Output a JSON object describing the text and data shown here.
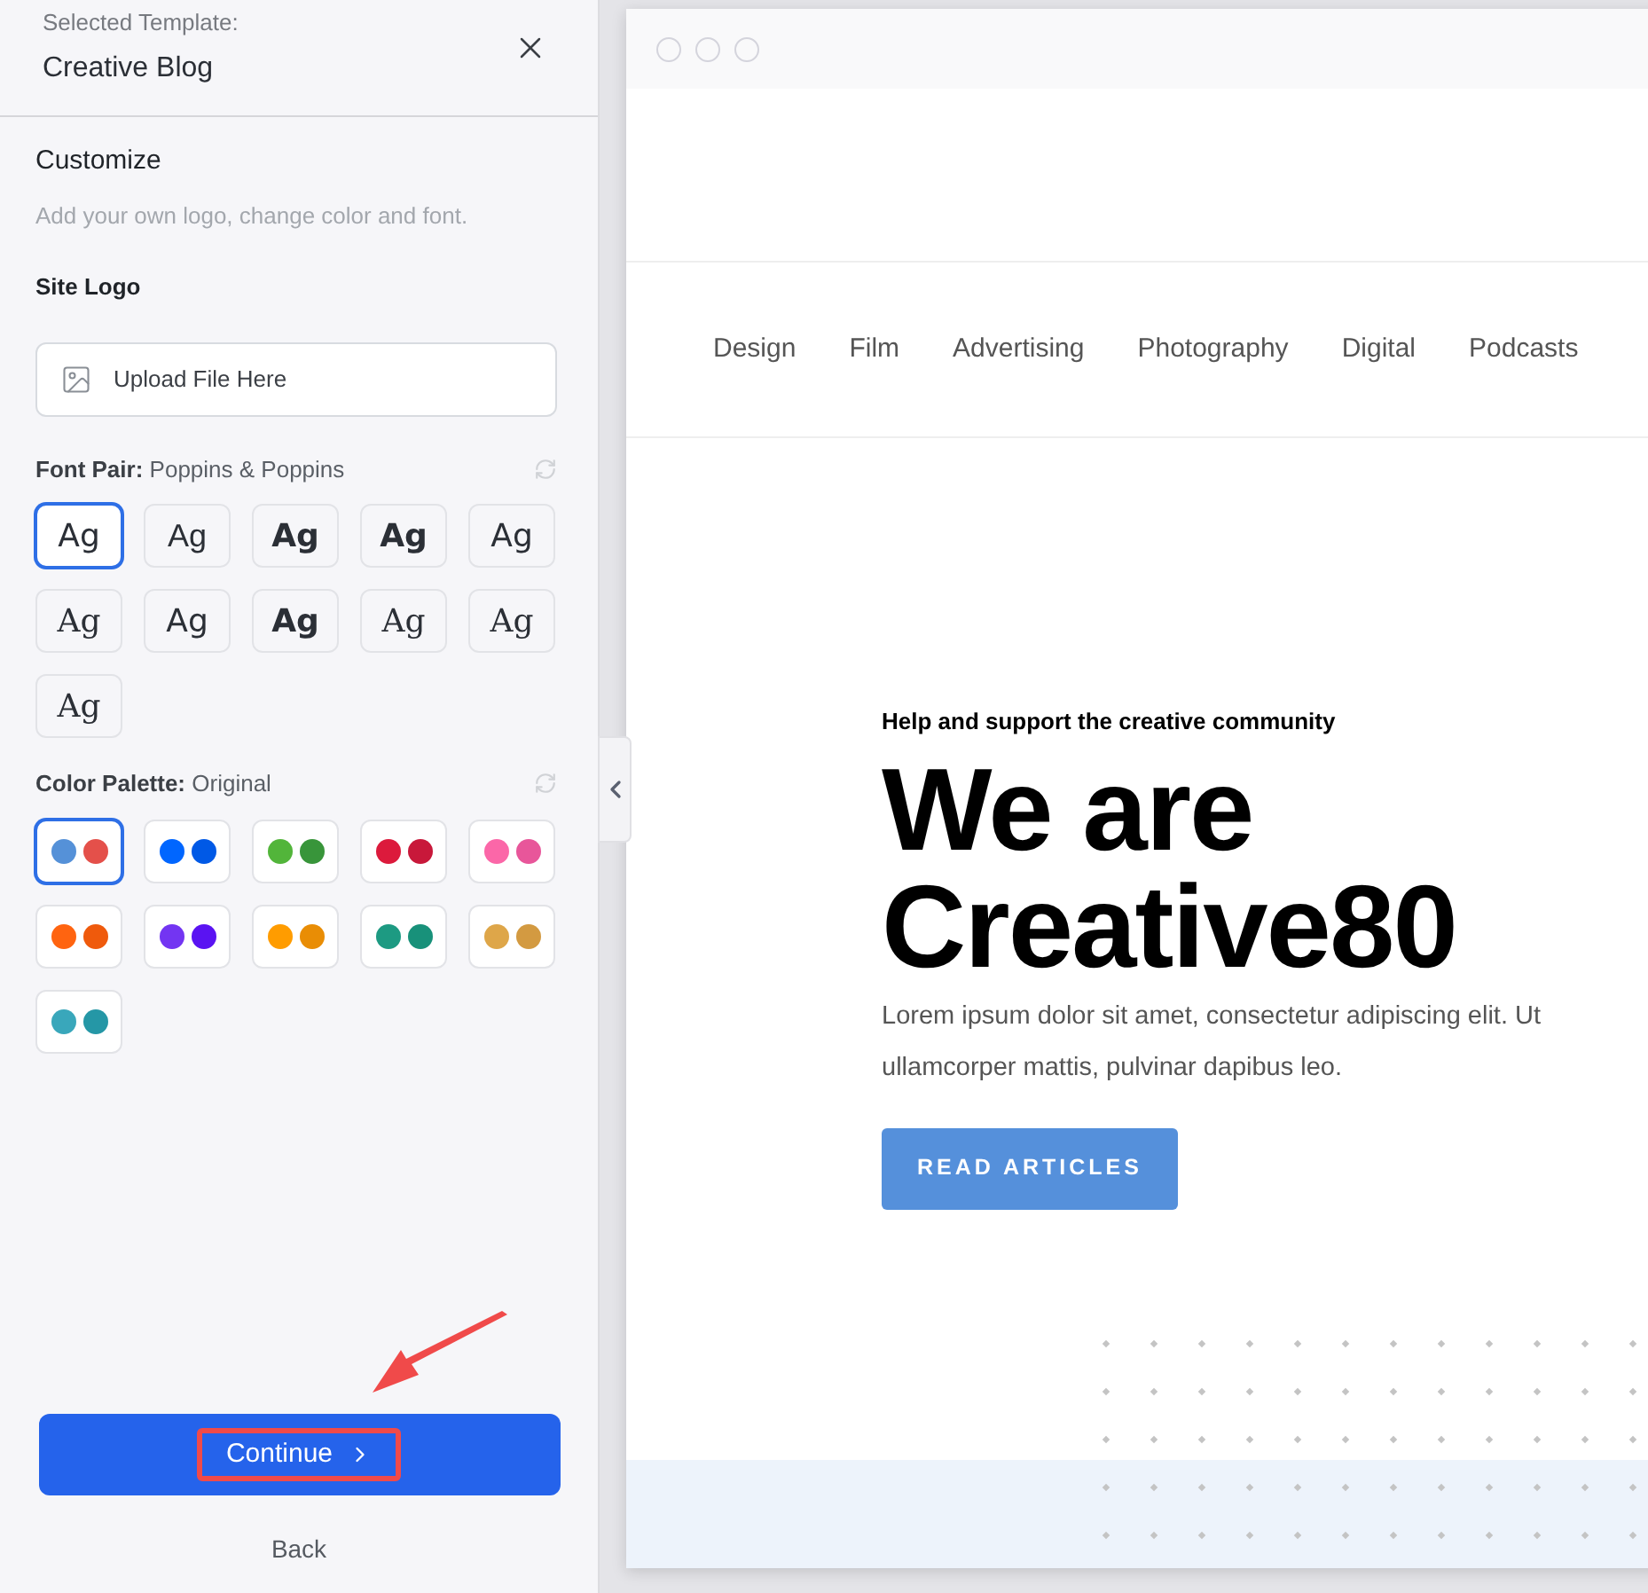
{
  "header": {
    "label": "Selected Template:",
    "template": "Creative Blog"
  },
  "customize": {
    "title": "Customize",
    "subtitle": "Add your own logo, change color and font."
  },
  "site_logo": {
    "label": "Site Logo",
    "upload": "Upload File Here"
  },
  "font_pair": {
    "label": "Font Pair:",
    "value": "Poppins & Poppins",
    "options": [
      {
        "sample": "Ag",
        "kind": "sans",
        "selected": true
      },
      {
        "sample": "Ag",
        "kind": "sans-light",
        "selected": false
      },
      {
        "sample": "Ag",
        "kind": "sans-bold",
        "selected": false
      },
      {
        "sample": "Ag",
        "kind": "sans-bold",
        "selected": false
      },
      {
        "sample": "Ag",
        "kind": "sans",
        "selected": false
      },
      {
        "sample": "Ag",
        "kind": "serif",
        "selected": false
      },
      {
        "sample": "Ag",
        "kind": "sans",
        "selected": false
      },
      {
        "sample": "Ag",
        "kind": "sans-bold",
        "selected": false
      },
      {
        "sample": "Ag",
        "kind": "serif",
        "selected": false
      },
      {
        "sample": "Ag",
        "kind": "serif",
        "selected": false
      },
      {
        "sample": "Ag",
        "kind": "serif",
        "selected": false
      }
    ]
  },
  "color_palette": {
    "label": "Color Palette:",
    "value": "Original",
    "options": [
      {
        "dots": [
          {
            "color": "#5591d8"
          },
          {
            "color": "#e4504a"
          }
        ],
        "selected": true
      },
      {
        "dots": [
          {
            "color": "#0066ff"
          },
          {
            "color": "#0059e6"
          }
        ],
        "selected": false
      },
      {
        "dots": [
          {
            "color": "#52b53a"
          },
          {
            "color": "#38953a"
          }
        ],
        "selected": false
      },
      {
        "dots": [
          {
            "color": "#dc1a3c"
          },
          {
            "color": "#c8183a"
          }
        ],
        "selected": false
      },
      {
        "dots": [
          {
            "color": "#fb67a8"
          },
          {
            "color": "#e8569a"
          }
        ],
        "selected": false
      },
      {
        "dots": [
          {
            "color": "#ff6410"
          },
          {
            "color": "#ef5a0c"
          }
        ],
        "selected": false
      },
      {
        "dots": [
          {
            "color": "#7335f2"
          },
          {
            "color": "#5a13f2"
          }
        ],
        "selected": false
      },
      {
        "dots": [
          {
            "color": "#ff9c00"
          },
          {
            "color": "#e98d05"
          }
        ],
        "selected": false
      },
      {
        "dots": [
          {
            "color": "#1d9a82"
          },
          {
            "color": "#18917a"
          }
        ],
        "selected": false
      },
      {
        "dots": [
          {
            "color": "#dea649"
          },
          {
            "color": "#d39a41"
          }
        ],
        "selected": false
      },
      {
        "dots": [
          {
            "color": "#39a7bb"
          },
          {
            "color": "#2597a6"
          }
        ],
        "selected": false
      }
    ]
  },
  "continue_button": {
    "label": "Continue",
    "highlighted": true
  },
  "back_link": "Back",
  "preview": {
    "nav": [
      "Design",
      "Film",
      "Advertising",
      "Photography",
      "Digital",
      "Podcasts"
    ],
    "eyebrow": "Help and support the creative community",
    "headline": "We are Creative80",
    "body": "Lorem ipsum dolor sit amet, consectetur adipiscing elit. Ut ullamcorper mattis, pulvinar dapibus leo.",
    "cta": "READ ARTICLES"
  }
}
